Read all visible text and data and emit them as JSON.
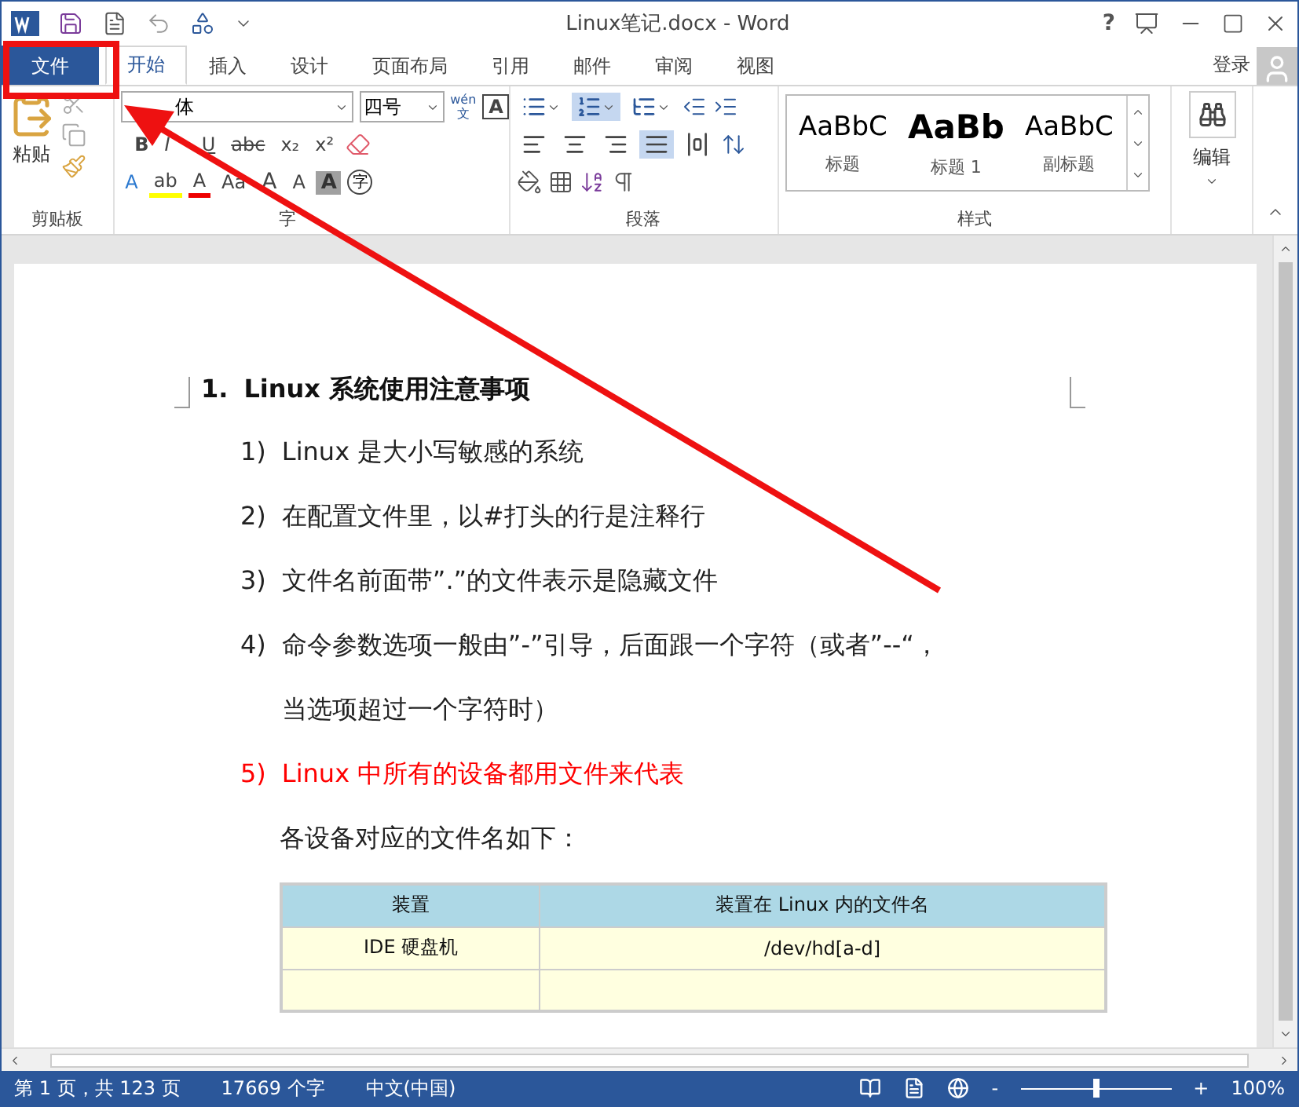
{
  "window": {
    "title": "Linux笔记.docx - Word",
    "help": "?"
  },
  "tabs": [
    {
      "label": "文件",
      "kind": "file",
      "selected": false
    },
    {
      "label": "开始",
      "kind": "tab",
      "selected": true
    },
    {
      "label": "插入",
      "kind": "tab",
      "selected": false
    },
    {
      "label": "设计",
      "kind": "tab",
      "selected": false
    },
    {
      "label": "页面布局",
      "kind": "tab",
      "selected": false
    },
    {
      "label": "引用",
      "kind": "tab",
      "selected": false
    },
    {
      "label": "邮件",
      "kind": "tab",
      "selected": false
    },
    {
      "label": "审阅",
      "kind": "tab",
      "selected": false
    },
    {
      "label": "视图",
      "kind": "tab",
      "selected": false
    }
  ],
  "account": {
    "label": "登录"
  },
  "clipboard": {
    "paste": "粘贴",
    "label": "剪贴板"
  },
  "font": {
    "name": "体",
    "size": "四号",
    "phonetic_top": "wén",
    "phonetic_bottom": "文",
    "border_char": "A",
    "format_buttons": [
      "B",
      "I",
      "U",
      "abc",
      "x₂",
      "x²"
    ],
    "effect_buttons": [
      "A",
      "ab",
      "A",
      "Aa"
    ],
    "grow": "A",
    "shrink": "A",
    "shade_char": "A",
    "enclose_char": "字",
    "label": "字"
  },
  "paragraph": {
    "lists": [
      {
        "kind": "bullets",
        "selected": false
      },
      {
        "kind": "numbering",
        "selected": true
      },
      {
        "kind": "multilevel",
        "selected": false
      }
    ],
    "alignments": [
      {
        "kind": "left",
        "selected": false
      },
      {
        "kind": "center",
        "selected": false
      },
      {
        "kind": "right",
        "selected": false
      },
      {
        "kind": "justify",
        "selected": true
      },
      {
        "kind": "distributed",
        "selected": false
      }
    ],
    "label": "段落"
  },
  "styles": {
    "items": [
      {
        "sample": "AaBbC",
        "name": "标题",
        "bold": false
      },
      {
        "sample": "AaBb",
        "name": "标题 1",
        "bold": true
      },
      {
        "sample": "AaBbC",
        "name": "副标题",
        "bold": false
      }
    ],
    "label": "样式"
  },
  "editing": {
    "label": "编辑"
  },
  "document": {
    "heading_number": "1.",
    "heading": "Linux 系统使用注意事项",
    "items": [
      {
        "number": "1)",
        "lines": [
          "Linux 是大小写敏感的系统"
        ],
        "color": "#222222"
      },
      {
        "number": "2)",
        "lines": [
          "在配置文件里，以#打头的行是注释行"
        ],
        "color": "#222222"
      },
      {
        "number": "3)",
        "lines": [
          "文件名前面带”.”的文件表示是隐藏文件"
        ],
        "color": "#222222"
      },
      {
        "number": "4)",
        "lines": [
          "命令参数选项一般由”-”引导，后面跟一个字符（或者”--“，",
          "当选项超过一个字符时）"
        ],
        "color": "#222222"
      },
      {
        "number": "5)",
        "lines": [
          "Linux 中所有的设备都用文件来代表"
        ],
        "color": "#ff0000"
      }
    ],
    "note": "各设备对应的文件名如下：",
    "table": {
      "columns": [
        "装置",
        "装置在 Linux 内的文件名"
      ],
      "rows": [
        [
          "IDE 硬盘机",
          "/dev/hd[a-d]"
        ]
      ]
    }
  },
  "status_bar": {
    "page": "第 1 页，共 123 页",
    "words": "17669 个字",
    "language": "中文(中国)",
    "zoom_minus": "-",
    "zoom_plus": "+",
    "zoom": "100%",
    "level": 0.5
  },
  "annotations": {
    "highlight_box": true,
    "arrow": true
  }
}
